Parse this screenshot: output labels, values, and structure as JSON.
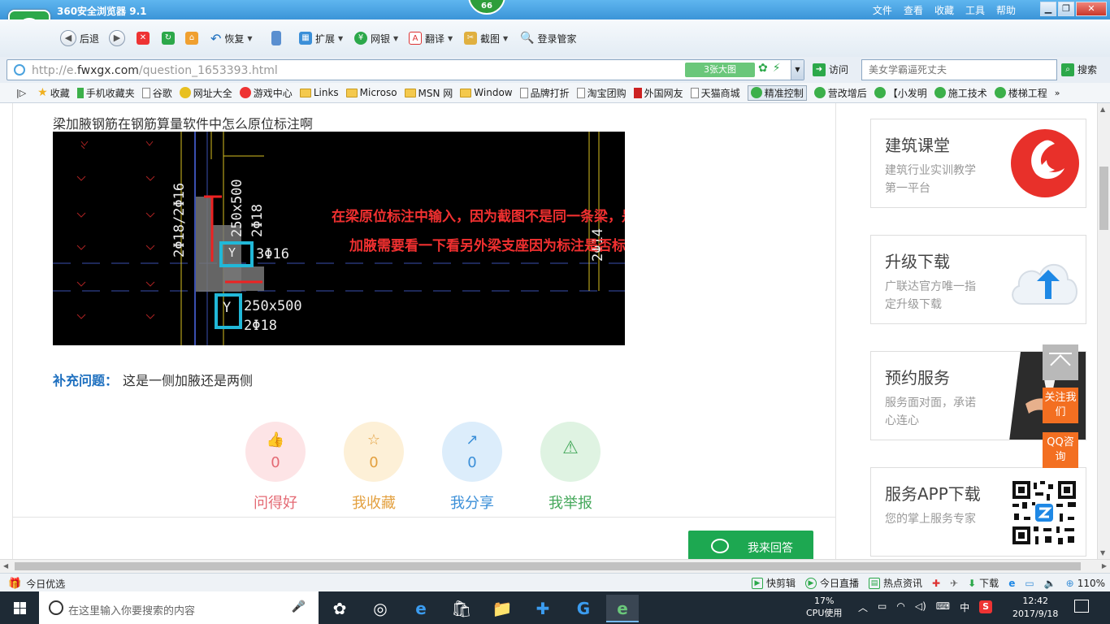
{
  "window": {
    "title": "360安全浏览器 9.1",
    "badge": "66",
    "menus": [
      "文件",
      "查看",
      "收藏",
      "工具",
      "帮助"
    ],
    "controls": [
      "▁",
      "❐",
      "✕"
    ]
  },
  "toolbar": {
    "back": "后退",
    "restore": "恢复",
    "extend": "扩展",
    "bank": "网银",
    "translate": "翻译",
    "screenshot": "截图",
    "login_manager": "登录管家"
  },
  "addressbar": {
    "url_prefix": "http://e.",
    "url_domain": "fwxgx.com",
    "url_path": "/question_1653393.html",
    "images_count": "3张大图",
    "visit": "访问",
    "search_placeholder": "美女学霸逼死丈夫",
    "search": "搜索"
  },
  "bookmarks": [
    {
      "label": "收藏",
      "icon": "star-icon"
    },
    {
      "label": "手机收藏夹",
      "icon": "phone-icon"
    },
    {
      "label": "谷歌",
      "icon": "page-icon"
    },
    {
      "label": "网址大全",
      "icon": "plus-icon"
    },
    {
      "label": "游戏中心",
      "icon": "game-icon"
    },
    {
      "label": "Links",
      "icon": "folder-icon"
    },
    {
      "label": "Microso",
      "icon": "folder-icon"
    },
    {
      "label": "MSN 网",
      "icon": "folder-icon"
    },
    {
      "label": "Window",
      "icon": "folder-icon"
    },
    {
      "label": "品牌打折",
      "icon": "page-icon"
    },
    {
      "label": "淘宝团购",
      "icon": "page-icon"
    },
    {
      "label": "外国网友",
      "icon": "page-icon"
    },
    {
      "label": "天猫商城",
      "icon": "page-icon"
    },
    {
      "label": "精准控制",
      "icon": "wechat-icon"
    },
    {
      "label": "营改增后",
      "icon": "wechat-icon"
    },
    {
      "label": "【小发明",
      "icon": "wechat-icon"
    },
    {
      "label": "施工技术",
      "icon": "wechat-icon"
    },
    {
      "label": "楼梯工程",
      "icon": "wechat-icon"
    }
  ],
  "question": {
    "title": "梁加腋钢筋在钢筋算量软件中怎么原位标注啊",
    "image": {
      "annotation_line1": "在梁原位标注中输入，因为截图不是同一条梁，是否二边",
      "annotation_line2": "加腋需要看一下看另外梁支座因为标注是否标注“Y”",
      "label_left_vertical": "2Φ18/2Φ16",
      "label_top_size": "250x500",
      "label_top_bars": "2Φ18",
      "label_mid": "3Φ16",
      "label_bottom_size": "250x500",
      "label_bottom_bars": "2Φ18",
      "label_y": "Y",
      "label_right_vertical": "2Φ14"
    },
    "supplement_label": "补充问题：",
    "supplement_text": "这是一侧加腋还是两侧"
  },
  "actions": [
    {
      "label": "问得好",
      "count": "0",
      "icon": "thumbs-up-icon",
      "color": "#e46a74",
      "bg": "#fde4e6"
    },
    {
      "label": "我收藏",
      "count": "0",
      "icon": "star-icon",
      "color": "#e3a03f",
      "bg": "#fdf0d7"
    },
    {
      "label": "我分享",
      "count": "0",
      "icon": "share-icon",
      "color": "#3b8fd8",
      "bg": "#dcedfb"
    },
    {
      "label": "我举报",
      "count": "",
      "icon": "warning-icon",
      "color": "#44a85a",
      "bg": "#dff3e2"
    }
  ],
  "answer_button": "我来回答",
  "sidebar": [
    {
      "title": "建筑课堂",
      "subtitle": "建筑行业实训教学第一平台"
    },
    {
      "title": "升级下载",
      "subtitle": "广联达官方唯一指定升级下载"
    },
    {
      "title": "预约服务",
      "subtitle": "服务面对面，承诺心连心"
    },
    {
      "title": "服务APP下载",
      "subtitle": "您的掌上服务专家"
    }
  ],
  "float_buttons": {
    "follow": "关注我们",
    "qq": "QQ咨询"
  },
  "statusbar": {
    "left": "今日优选",
    "items": [
      "快剪辑",
      "今日直播",
      "热点资讯",
      "下载"
    ],
    "zoom": "110%"
  },
  "taskbar": {
    "search_placeholder": "在这里输入你要搜索的内容",
    "cpu_percent": "17%",
    "cpu_label": "CPU使用",
    "ime": "中",
    "time": "12:42",
    "date": "2017/9/18"
  }
}
